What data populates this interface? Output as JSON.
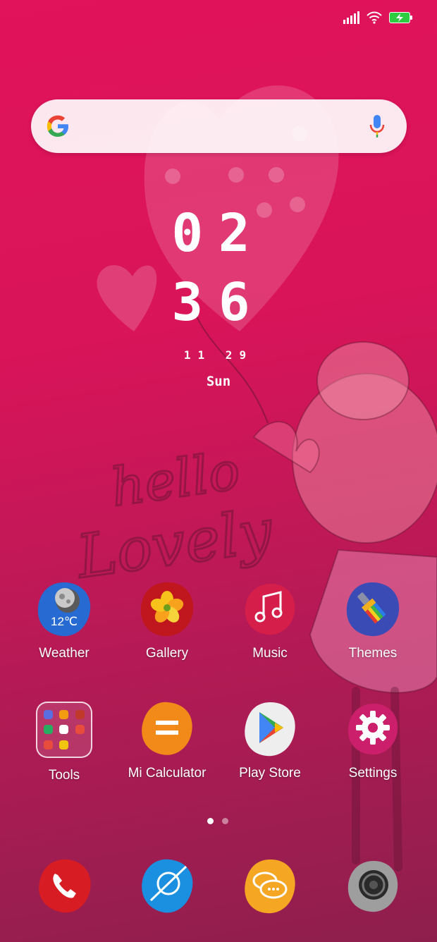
{
  "status": {
    "battery_color": "#2ecc40"
  },
  "search": {
    "g_icon": "google-g-icon",
    "mic_icon": "mic-icon"
  },
  "clock": {
    "hour": "02",
    "minute": "36",
    "date": "11 29",
    "weekday": "Sun"
  },
  "apps_row1": [
    {
      "label": "Weather",
      "icon": "weather-icon",
      "badge": "12℃"
    },
    {
      "label": "Gallery",
      "icon": "gallery-icon"
    },
    {
      "label": "Music",
      "icon": "music-icon"
    },
    {
      "label": "Themes",
      "icon": "themes-icon"
    }
  ],
  "apps_row2": [
    {
      "label": "Tools",
      "icon": "folder-icon"
    },
    {
      "label": "Mi Calculator",
      "icon": "calculator-icon"
    },
    {
      "label": "Play Store",
      "icon": "play-store-icon"
    },
    {
      "label": "Settings",
      "icon": "settings-icon"
    }
  ],
  "pager": {
    "pages": 2,
    "current": 1
  },
  "dock": [
    {
      "icon": "phone-icon"
    },
    {
      "icon": "browser-icon"
    },
    {
      "icon": "messaging-icon"
    },
    {
      "icon": "camera-icon"
    }
  ],
  "colors": {
    "weather": "#1e6fd9",
    "gallery": "#c0171f",
    "music": "#d61e4a",
    "themes": "#3a4bb6",
    "calculator": "#f28a1a",
    "settings": "#cc1f6b",
    "phone": "#d81c23",
    "browser": "#1b8fe0",
    "messaging": "#f5a623",
    "camera": "#9e9e9e"
  }
}
